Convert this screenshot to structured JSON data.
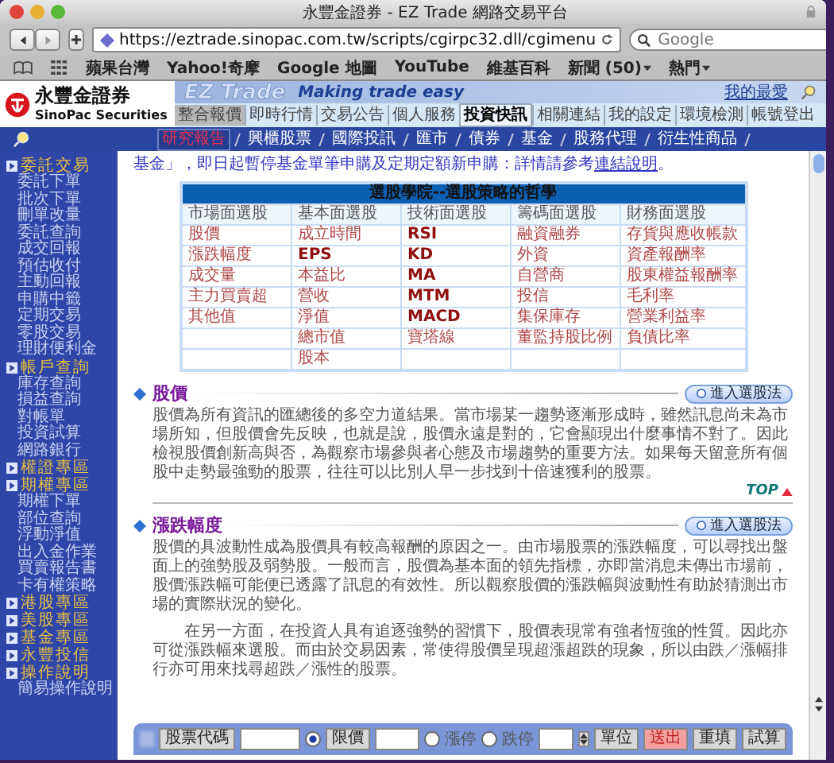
{
  "window": {
    "title": "永豐金證券 - EZ Trade 網路交易平台"
  },
  "toolbar": {
    "url": "https://eztrade.sinopac.com.tw/scripts/cgirpc32.dll/cgimenu",
    "search_placeholder": "Google"
  },
  "bookmarks": [
    {
      "label": "蘋果台灣",
      "menu": false
    },
    {
      "label": "Yahoo!奇摩",
      "menu": false
    },
    {
      "label": "Google 地圖",
      "menu": false
    },
    {
      "label": "YouTube",
      "menu": false
    },
    {
      "label": "維基百科",
      "menu": false
    },
    {
      "label": "新聞 (50)",
      "menu": true
    },
    {
      "label": "熱門",
      "menu": true
    }
  ],
  "site": {
    "logo_zh": "永豐金證券",
    "logo_en": "SinoPac Securities",
    "brand": "EZ Trade",
    "tagline": "Making trade easy",
    "favorites": "我的最愛"
  },
  "nav": [
    {
      "label": "整合報價",
      "highlighted": true,
      "selected": false
    },
    {
      "label": "即時行情",
      "highlighted": false,
      "selected": false
    },
    {
      "label": "交易公告",
      "highlighted": false,
      "selected": false
    },
    {
      "label": "個人服務",
      "highlighted": false,
      "selected": false
    },
    {
      "label": "投資快訊",
      "highlighted": false,
      "selected": true
    },
    {
      "label": "相關連結",
      "highlighted": false,
      "selected": false
    },
    {
      "label": "我的設定",
      "highlighted": false,
      "selected": false
    },
    {
      "label": "環境檢測",
      "highlighted": false,
      "selected": false
    },
    {
      "label": "帳號登出",
      "highlighted": false,
      "selected": false
    }
  ],
  "subnav": [
    {
      "label": "研究報告",
      "selected": true
    },
    {
      "label": "興櫃股票",
      "selected": false
    },
    {
      "label": "國際投訊",
      "selected": false
    },
    {
      "label": "匯市",
      "selected": false
    },
    {
      "label": "債券",
      "selected": false
    },
    {
      "label": "基金",
      "selected": false
    },
    {
      "label": "股務代理",
      "selected": false
    },
    {
      "label": "衍生性商品",
      "selected": false
    }
  ],
  "sidebar": [
    {
      "label": "委託交易",
      "children": [
        {
          "label": "委託下單"
        },
        {
          "label": "批次下單"
        },
        {
          "label": "刪單改量"
        },
        {
          "label": "委託查詢"
        },
        {
          "label": "成交回報"
        },
        {
          "label": "預估收付"
        },
        {
          "label": "主動回報"
        },
        {
          "label": "申購中籤"
        },
        {
          "label": "定期交易"
        },
        {
          "label": "零股交易"
        },
        {
          "label": "理財便利金"
        }
      ]
    },
    {
      "label": "帳戶查詢",
      "children": [
        {
          "label": "庫存查詢"
        },
        {
          "label": "損益查詢"
        },
        {
          "label": "對帳單"
        },
        {
          "label": "投資試算"
        },
        {
          "label": "網路銀行"
        }
      ]
    },
    {
      "label": "權證專區"
    },
    {
      "label": "期權專區",
      "children": [
        {
          "label": "期權下單"
        },
        {
          "label": "部位查詢"
        },
        {
          "label": "浮動淨值"
        },
        {
          "label": "出入金作業"
        },
        {
          "label": "買賣報告書"
        },
        {
          "label": "卡有權策略"
        }
      ]
    },
    {
      "label": "港股專區"
    },
    {
      "label": "美股專區"
    },
    {
      "label": "基金專區"
    },
    {
      "label": "永豐投信"
    },
    {
      "label": "操作說明",
      "children": [
        {
          "label": "簡易操作說明"
        }
      ]
    }
  ],
  "notice": {
    "text": "基金」，即日起暫停基金單筆申購及定期定額新申購：詳情請參考",
    "link": "連結說明",
    "end": "。"
  },
  "table": {
    "title": "選股學院--選股策略的哲學",
    "columns": [
      "市場面選股",
      "基本面選股",
      "技術面選股",
      "籌碼面選股",
      "財務面選股"
    ],
    "rows": [
      [
        {
          "text": "股價",
          "bold": false
        },
        {
          "text": "成立時間",
          "bold": false
        },
        {
          "text": "RSI",
          "bold": true
        },
        {
          "text": "融資融券",
          "bold": false
        },
        {
          "text": "存貨與應收帳款",
          "bold": false
        }
      ],
      [
        {
          "text": "漲跌幅度",
          "bold": false
        },
        {
          "text": "EPS",
          "bold": true
        },
        {
          "text": "KD",
          "bold": true
        },
        {
          "text": "外資",
          "bold": false
        },
        {
          "text": "資產報酬率",
          "bold": false
        }
      ],
      [
        {
          "text": "成交量",
          "bold": false
        },
        {
          "text": "本益比",
          "bold": false
        },
        {
          "text": "MA",
          "bold": true
        },
        {
          "text": "自營商",
          "bold": false
        },
        {
          "text": "股東權益報酬率",
          "bold": false
        }
      ],
      [
        {
          "text": "主力買賣超",
          "bold": false
        },
        {
          "text": "營收",
          "bold": false
        },
        {
          "text": "MTM",
          "bold": true
        },
        {
          "text": "投信",
          "bold": false
        },
        {
          "text": "毛利率",
          "bold": false
        }
      ],
      [
        {
          "text": "其他值",
          "bold": false
        },
        {
          "text": "淨值",
          "bold": false
        },
        {
          "text": "MACD",
          "bold": true
        },
        {
          "text": "集保庫存",
          "bold": false
        },
        {
          "text": "營業利益率",
          "bold": false
        }
      ],
      [
        null,
        {
          "text": "總市值",
          "bold": false
        },
        {
          "text": "寶塔線",
          "bold": false
        },
        {
          "text": "董監持股比例",
          "bold": false
        },
        {
          "text": "負債比率",
          "bold": false
        }
      ],
      [
        null,
        {
          "text": "股本",
          "bold": false
        },
        null,
        null,
        null
      ]
    ]
  },
  "sections": [
    {
      "title": "股價",
      "button": "進入選股法",
      "paragraphs": [
        "股價為所有資訊的匯總後的多空力道結果。當市場某一趨勢逐漸形成時，雖然訊息尚未為市場所知，但股價會先反映，也就是說，股價永遠是對的，它會顯現出什麼事情不對了。因此檢視股價創新高與否，為觀察市場參與者心態及市場趨勢的重要方法。如果每天留意所有個股中走勢最強勁的股票，往往可以比別人早一步找到十倍速獲利的股票。"
      ],
      "top": "TOP"
    },
    {
      "title": "漲跌幅度",
      "button": "進入選股法",
      "paragraphs": [
        "股價的具波動性成為股價具有較高報酬的原因之一。由市場股票的漲跌幅度，可以尋找出盤面上的強勢股及弱勢股。一般而言，股價為基本面的領先指標，亦即當消息未傳出市場前，股價漲跌幅可能便已透露了訊息的有效性。所以觀察股價的漲跌幅與波動性有助於猜測出市場的實際狀況的變化。",
        "在另一方面，在投資人具有追逐強勢的習慣下，股價表現常有強者恆強的性質。因此亦可從漲跌幅來選股。而由於交易因素，常使得股價呈現超漲超跌的現象，所以由跌／漲幅排行亦可用來找尋超跌／漲性的股票。"
      ]
    }
  ],
  "order_bar": {
    "code_button": "股票代碼",
    "price_types": [
      {
        "label": "限價",
        "kind": "button",
        "selected": true
      },
      {
        "label": "漲停",
        "kind": "text",
        "selected": false
      },
      {
        "label": "跌停",
        "kind": "text",
        "selected": false
      }
    ],
    "actions": [
      {
        "label": "單位",
        "primary": false
      },
      {
        "label": "送出",
        "primary": true
      },
      {
        "label": "重填",
        "primary": false
      },
      {
        "label": "試算",
        "primary": false
      }
    ]
  }
}
